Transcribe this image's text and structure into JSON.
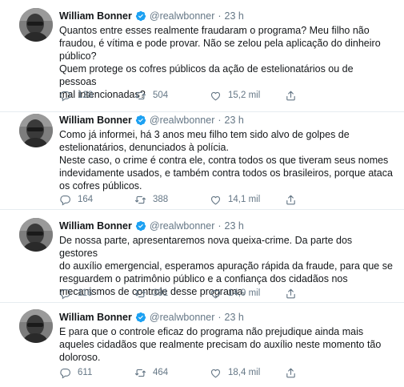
{
  "tweets": [
    {
      "name": "William Bonner",
      "handle": "@realwbonner",
      "time": "23 h",
      "lines": [
        "Quantos entre esses realmente fraudaram o programa? Meu filho não",
        "fraudou, é vítima e pode provar. Não se zelou pela aplicação do dinheiro",
        "público?",
        "Quem protege os cofres públicos da ação de estelionatários ou de pessoas",
        "mal intencionadas?"
      ],
      "replies": "128",
      "retweets": "504",
      "likes": "15,2 mil"
    },
    {
      "name": "William Bonner",
      "handle": "@realwbonner",
      "time": "23 h",
      "lines": [
        "Como já informei, há 3 anos meu filho tem sido alvo de golpes de",
        "estelionatários, denunciados à polícia.",
        "Neste caso, o crime é contra ele, contra todos os que tiveram seus nomes",
        "indevidamente usados, e também contra todos os brasileiros, porque ataca",
        "os cofres públicos."
      ],
      "replies": "164",
      "retweets": "388",
      "likes": "14,1 mil"
    },
    {
      "name": "William Bonner",
      "handle": "@realwbonner",
      "time": "23 h",
      "lines": [
        "De nossa parte, apresentaremos nova queixa-crime. Da parte dos gestores",
        "do auxílio emergencial, esperamos apuração rápida da fraude, para que se",
        "resguardem o patrimônio público e a confiança dos cidadãos nos",
        "mecanismos de controle desse programa."
      ],
      "replies": "116",
      "retweets": "391",
      "likes": "14,9 mil"
    },
    {
      "name": "William Bonner",
      "handle": "@realwbonner",
      "time": "23 h",
      "lines": [
        "E para que o controle eficaz do programa não prejudique ainda mais",
        "aqueles cidadãos que realmente precisam do auxílio neste momento tão",
        "doloroso."
      ],
      "replies": "611",
      "retweets": "464",
      "likes": "18,4 mil"
    }
  ],
  "separator": "·",
  "colors": {
    "verified": "#1da1f2",
    "muted": "#657786",
    "text": "#14171a",
    "divider": "#e6ecf0"
  },
  "icons": {
    "verified": "verified-badge-icon",
    "reply": "reply-icon",
    "retweet": "retweet-icon",
    "like": "heart-icon",
    "share": "share-icon"
  }
}
